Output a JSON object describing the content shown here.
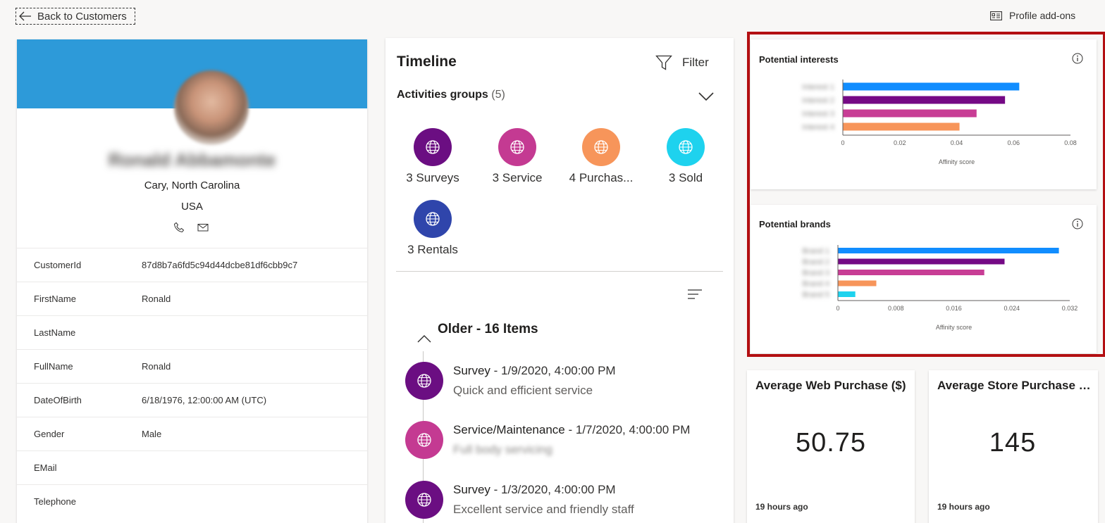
{
  "header": {
    "back_label": "Back to Customers",
    "addons_label": "Profile add-ons"
  },
  "profile": {
    "name": "Ronald Abbamonte",
    "city": "Cary, North Carolina",
    "country": "USA",
    "banner_color": "#2d9ad9",
    "fields": [
      {
        "key": "CustomerId",
        "value": "87d8b7a6fd5c94d44dcbe81df6cbb9c7"
      },
      {
        "key": "FirstName",
        "value": "Ronald"
      },
      {
        "key": "LastName",
        "value": ""
      },
      {
        "key": "FullName",
        "value": "Ronald"
      },
      {
        "key": "DateOfBirth",
        "value": "6/18/1976, 12:00:00 AM (UTC)"
      },
      {
        "key": "Gender",
        "value": "Male"
      },
      {
        "key": "EMail",
        "value": ""
      },
      {
        "key": "Telephone",
        "value": ""
      }
    ]
  },
  "timeline": {
    "title": "Timeline",
    "filter_label": "Filter",
    "groups_title": "Activities groups",
    "groups_count": "(5)",
    "groups": [
      {
        "label": "3 Surveys",
        "color": "#6b0e82",
        "icon": "globe-icon"
      },
      {
        "label": "3 Service",
        "color": "#c43a92",
        "icon": "globe-icon"
      },
      {
        "label": "4 Purchas...",
        "color": "#f7955a",
        "icon": "globe-icon"
      },
      {
        "label": "3 Sold",
        "color": "#1ed2ee",
        "icon": "globe-icon"
      },
      {
        "label": "3 Rentals",
        "color": "#2f45ab",
        "icon": "globe-icon"
      }
    ],
    "older_title": "Older - 16 Items",
    "entries": [
      {
        "type": "Survey",
        "date": " - 1/9/2020, 4:00:00 PM",
        "detail": "Quick and efficient service",
        "color": "#6b0e82",
        "blurred": false
      },
      {
        "type": "Service/Maintenance",
        "date": " - 1/7/2020, 4:00:00 PM",
        "detail": "Full body servicing",
        "color": "#c43a92",
        "blurred": true
      },
      {
        "type": "Survey",
        "date": " - 1/3/2020, 4:00:00 PM",
        "detail": "Excellent service and friendly staff",
        "color": "#6b0e82",
        "blurred": false
      }
    ]
  },
  "charts": {
    "interests_title": "Potential interests",
    "brands_title": "Potential brands"
  },
  "chart_data": [
    {
      "type": "bar",
      "orientation": "horizontal",
      "title": "Potential interests",
      "xlabel": "Affinity score",
      "categories": [
        "Interest 1",
        "Interest 2",
        "Interest 3",
        "Interest 4"
      ],
      "values": [
        0.062,
        0.057,
        0.047,
        0.041
      ],
      "colors": [
        "#118dff",
        "#750985",
        "#c83d95",
        "#f7955a"
      ],
      "xlim": [
        0,
        0.08
      ],
      "xticks": [
        "0",
        "0.02",
        "0.04",
        "0.06",
        "0.08"
      ]
    },
    {
      "type": "bar",
      "orientation": "horizontal",
      "title": "Potential brands",
      "xlabel": "Affinity score",
      "categories": [
        "Brand 1",
        "Brand 2",
        "Brand 3",
        "Brand 4",
        "Brand 5"
      ],
      "values": [
        0.0305,
        0.023,
        0.0202,
        0.0053,
        0.0024
      ],
      "colors": [
        "#118dff",
        "#750985",
        "#c83d95",
        "#f7955a",
        "#1ed2ee"
      ],
      "xlim": [
        0,
        0.032
      ],
      "xticks": [
        "0",
        "0.008",
        "0.016",
        "0.024",
        "0.032"
      ]
    }
  ],
  "kpis": [
    {
      "title": "Average Web Purchase ($)",
      "value": "50.75",
      "updated": "19 hours ago"
    },
    {
      "title": "Average Store Purchase (...",
      "value": "145",
      "updated": "19 hours ago"
    }
  ]
}
